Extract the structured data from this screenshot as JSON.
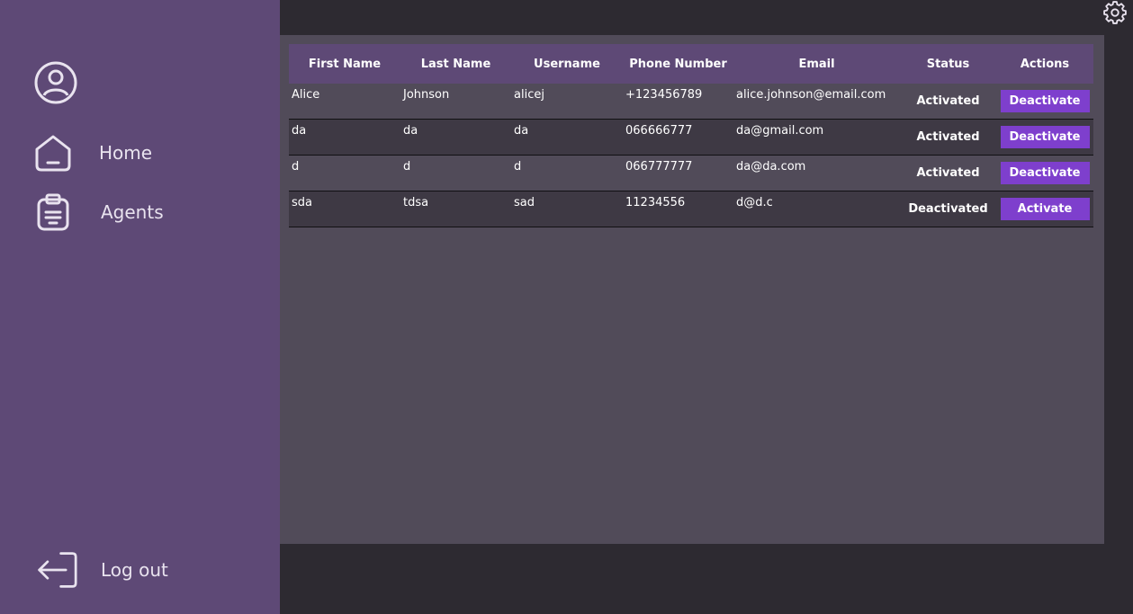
{
  "sidebar": {
    "avatar_icon": "user-circle-icon",
    "items": [
      {
        "label": "Home",
        "icon": "home-icon"
      },
      {
        "label": "Agents",
        "icon": "clipboard-icon"
      }
    ],
    "logout": {
      "label": "Log out",
      "icon": "logout-arrow-icon"
    }
  },
  "header": {
    "settings_icon": "gear-icon"
  },
  "table": {
    "columns": [
      "First Name",
      "Last Name",
      "Username",
      "Phone Number",
      "Email",
      "Status",
      "Actions"
    ],
    "rows": [
      {
        "first": "Alice",
        "last": "Johnson",
        "username": "alicej",
        "phone": "+123456789",
        "email": "alice.johnson@email.com",
        "status": "Activated",
        "action": "Deactivate"
      },
      {
        "first": "da",
        "last": "da",
        "username": "da",
        "phone": "066666777",
        "email": "da@gmail.com",
        "status": "Activated",
        "action": "Deactivate"
      },
      {
        "first": "d",
        "last": "d",
        "username": "d",
        "phone": "066777777",
        "email": "da@da.com",
        "status": "Activated",
        "action": "Deactivate"
      },
      {
        "first": "sda",
        "last": "tdsa",
        "username": "sad",
        "phone": "11234556",
        "email": "d@d.c",
        "status": "Deactivated",
        "action": "Activate"
      }
    ]
  },
  "colors": {
    "sidebar_bg": "#5e4976",
    "page_bg": "#2d2a31",
    "panel_bg": "#514b59",
    "button_bg": "#7e3fcd"
  }
}
